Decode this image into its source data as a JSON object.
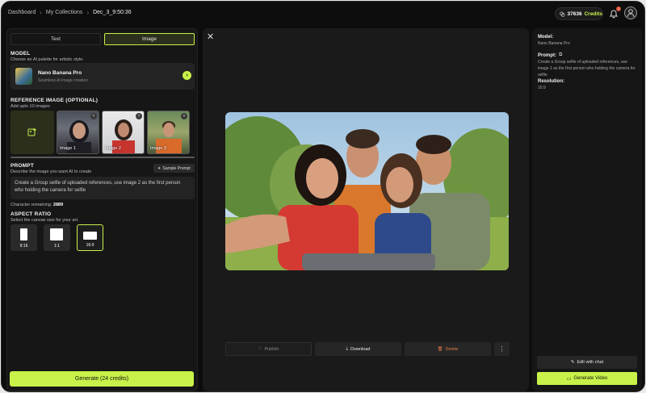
{
  "breadcrumb": [
    "Dashboard",
    "My Collections",
    "Dec_3_9:50:36"
  ],
  "header": {
    "credits_value": "37636",
    "credits_label": "Credits",
    "notification_count": "1"
  },
  "tabs": [
    {
      "label": "Text"
    },
    {
      "label": "Image"
    }
  ],
  "model": {
    "section_title": "MODEL",
    "section_sub": "Choose an AI palette for artistic style.",
    "name": "Nano Banana Pro",
    "description": "Seamless AI image creation"
  },
  "reference": {
    "section_title": "REFERENCE IMAGE (OPTIONAL)",
    "section_sub": "Add upto 10 images",
    "images": [
      {
        "label": "Image 1"
      },
      {
        "label": "Image 2"
      },
      {
        "label": "Image 3"
      }
    ]
  },
  "prompt": {
    "section_title": "PROMPT",
    "section_sub": "Describe the image you want AI to create",
    "sample_label": "Sample Prompt",
    "text": "Create a Group selfie of uploaded references, use image 2 as the first person who holding the camera for selfie",
    "chars_label": "Character remaining:",
    "chars_value": "2889"
  },
  "aspect": {
    "section_title": "ASPECT RATIO",
    "section_sub": "Select the canvas size for your art.",
    "options": [
      {
        "label": "9:16"
      },
      {
        "label": "1:1"
      },
      {
        "label": "16:9"
      }
    ],
    "selected": "16:9"
  },
  "generate_label": "Generate (24 credits)",
  "viewer_actions": {
    "publish": "Publish",
    "download": "Download",
    "delete": "Delete"
  },
  "details": {
    "model_title": "Model:",
    "model_value": "Nano Banana Pro",
    "prompt_title": "Prompt:",
    "prompt_value": "Create a Group selfie of uploaded references, use image 1 as the first person who holding the camera for selfie",
    "resolution_title": "Resolution:",
    "resolution_value": "16:9"
  },
  "right_actions": {
    "edit": "Edit with chat",
    "video": "Generate Video"
  },
  "colors": {
    "accent": "#c8f249",
    "delete": "#e27d4a",
    "background": "#0d0d0d"
  }
}
